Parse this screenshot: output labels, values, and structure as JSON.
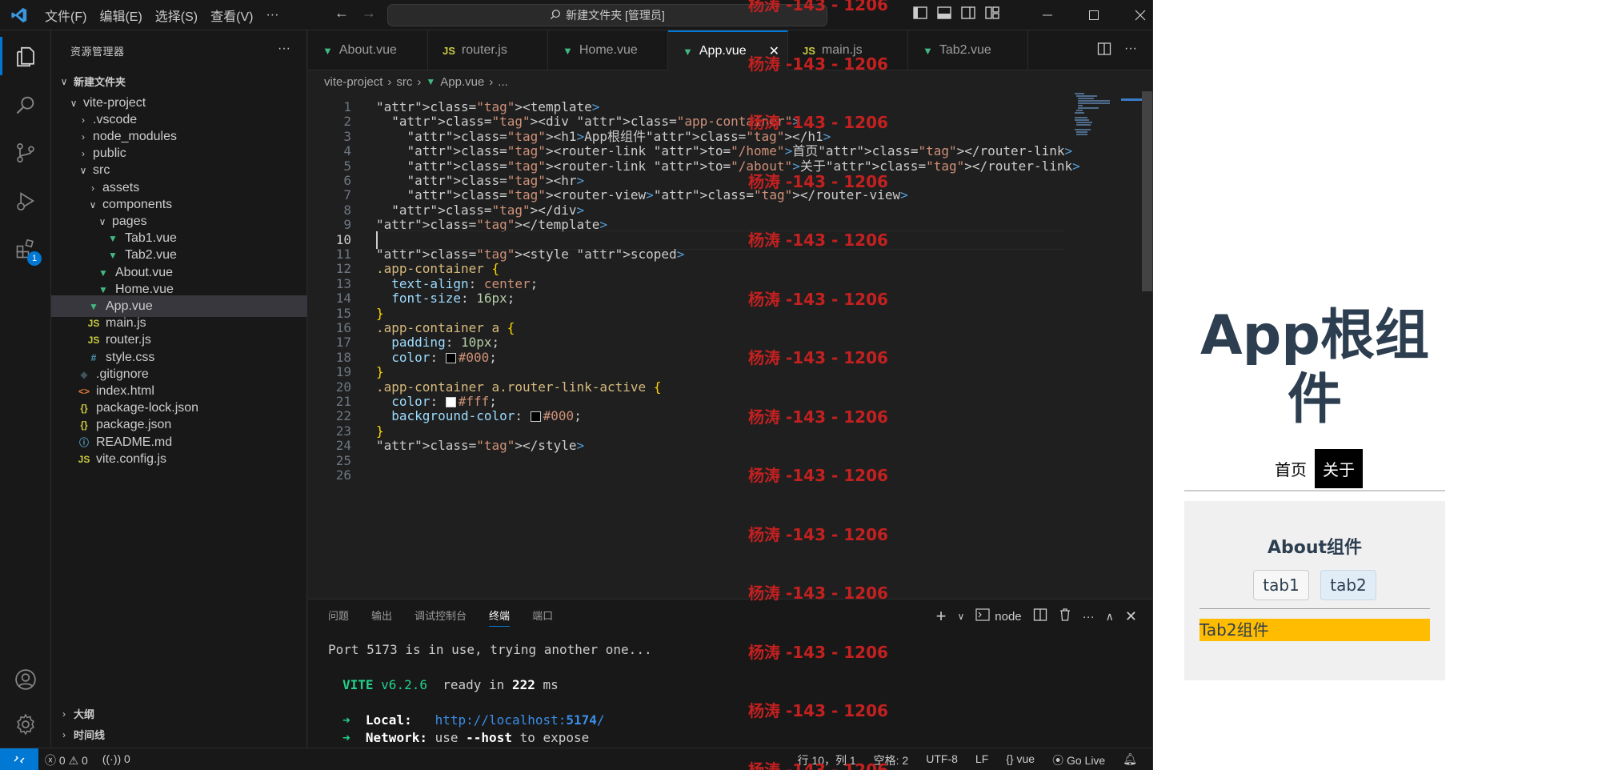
{
  "titlebar": {
    "menus": [
      "文件(F)",
      "编辑(E)",
      "选择(S)",
      "查看(V)",
      "···"
    ],
    "command_center": "新建文件夹 [管理员]"
  },
  "activity": {
    "extensions_badge": "1"
  },
  "sidebar": {
    "title": "资源管理器",
    "root": "新建文件夹",
    "tree": [
      {
        "label": "vite-project",
        "kind": "folder-open",
        "depth": 1
      },
      {
        "label": ".vscode",
        "kind": "folder",
        "depth": 2
      },
      {
        "label": "node_modules",
        "kind": "folder",
        "depth": 2
      },
      {
        "label": "public",
        "kind": "folder",
        "depth": 2
      },
      {
        "label": "src",
        "kind": "folder-open",
        "depth": 2
      },
      {
        "label": "assets",
        "kind": "folder",
        "depth": 3
      },
      {
        "label": "components",
        "kind": "folder-open",
        "depth": 3
      },
      {
        "label": "pages",
        "kind": "folder-open",
        "depth": 4
      },
      {
        "label": "Tab1.vue",
        "kind": "vue",
        "depth": 5
      },
      {
        "label": "Tab2.vue",
        "kind": "vue",
        "depth": 5
      },
      {
        "label": "About.vue",
        "kind": "vue",
        "depth": 4
      },
      {
        "label": "Home.vue",
        "kind": "vue",
        "depth": 4
      },
      {
        "label": "App.vue",
        "kind": "vue",
        "depth": 3,
        "selected": true
      },
      {
        "label": "main.js",
        "kind": "js",
        "depth": 3
      },
      {
        "label": "router.js",
        "kind": "js",
        "depth": 3
      },
      {
        "label": "style.css",
        "kind": "css",
        "depth": 3
      },
      {
        "label": ".gitignore",
        "kind": "git",
        "depth": 2
      },
      {
        "label": "index.html",
        "kind": "html",
        "depth": 2
      },
      {
        "label": "package-lock.json",
        "kind": "json",
        "depth": 2
      },
      {
        "label": "package.json",
        "kind": "json",
        "depth": 2
      },
      {
        "label": "README.md",
        "kind": "info",
        "depth": 2
      },
      {
        "label": "vite.config.js",
        "kind": "js",
        "depth": 2
      }
    ],
    "outline": "大纲",
    "timeline": "时间线"
  },
  "tabs": [
    {
      "label": "About.vue",
      "kind": "vue"
    },
    {
      "label": "router.js",
      "kind": "js"
    },
    {
      "label": "Home.vue",
      "kind": "vue"
    },
    {
      "label": "App.vue",
      "kind": "vue",
      "active": true
    },
    {
      "label": "main.js",
      "kind": "js"
    },
    {
      "label": "Tab2.vue",
      "kind": "vue"
    }
  ],
  "breadcrumb": [
    "vite-project",
    "src",
    "App.vue",
    "..."
  ],
  "code": {
    "current_line": 10,
    "lines": [
      "<template>",
      "  <div class=\"app-container\">",
      "    <h1>App根组件</h1>",
      "    <router-link to=\"/home\">首页</router-link>",
      "    <router-link to=\"/about\">关于</router-link>",
      "    <hr>",
      "    <router-view></router-view>",
      "  </div>",
      "</template>",
      "",
      "<style scoped>",
      ".app-container {",
      "  text-align: center;",
      "  font-size: 16px;",
      "}",
      ".app-container a {",
      "  padding: 10px;",
      "  color: #000;",
      "}",
      ".app-container a.router-link-active {",
      "  color: #fff;",
      "  background-color: #000;",
      "}",
      "</style>",
      "",
      ""
    ]
  },
  "panel": {
    "tabs": [
      "问题",
      "输出",
      "调试控制台",
      "终端",
      "端口"
    ],
    "active_tab": "终端",
    "terminal_name": "node",
    "terminal": {
      "line1": "Port 5173 is in use, trying another one...",
      "vite": "VITE",
      "version": "v6.2.6",
      "ready": "ready in",
      "ms_value": "222",
      "ms": "ms",
      "arrow": "➜",
      "local_label": "Local:",
      "local_url_prefix": "http://localhost:",
      "local_port": "5174",
      "local_url_suffix": "/",
      "network_label": "Network:",
      "network_text_1": "use",
      "network_flag": "--host",
      "network_text_2": "to expose"
    }
  },
  "statusbar": {
    "errors": "0",
    "warnings": "0",
    "ports": "0",
    "position": "行 10，列 1",
    "spaces": "空格: 2",
    "encoding": "UTF-8",
    "eol": "LF",
    "language": "vue",
    "golive": "Go Live"
  },
  "watermark": "杨涛 -143 - 1206",
  "preview": {
    "h1": "App根组件",
    "links": [
      "首页",
      "关于"
    ],
    "active_link": "关于",
    "about_title": "About组件",
    "tab_buttons": [
      "tab1",
      "tab2"
    ],
    "active_tab": "tab2",
    "tab_content": "Tab2组件",
    "tab_content_color": "#ffbc00"
  },
  "colors": {
    "accent": "#0078d4",
    "vue": "#42b883",
    "js": "#cbcb41"
  }
}
